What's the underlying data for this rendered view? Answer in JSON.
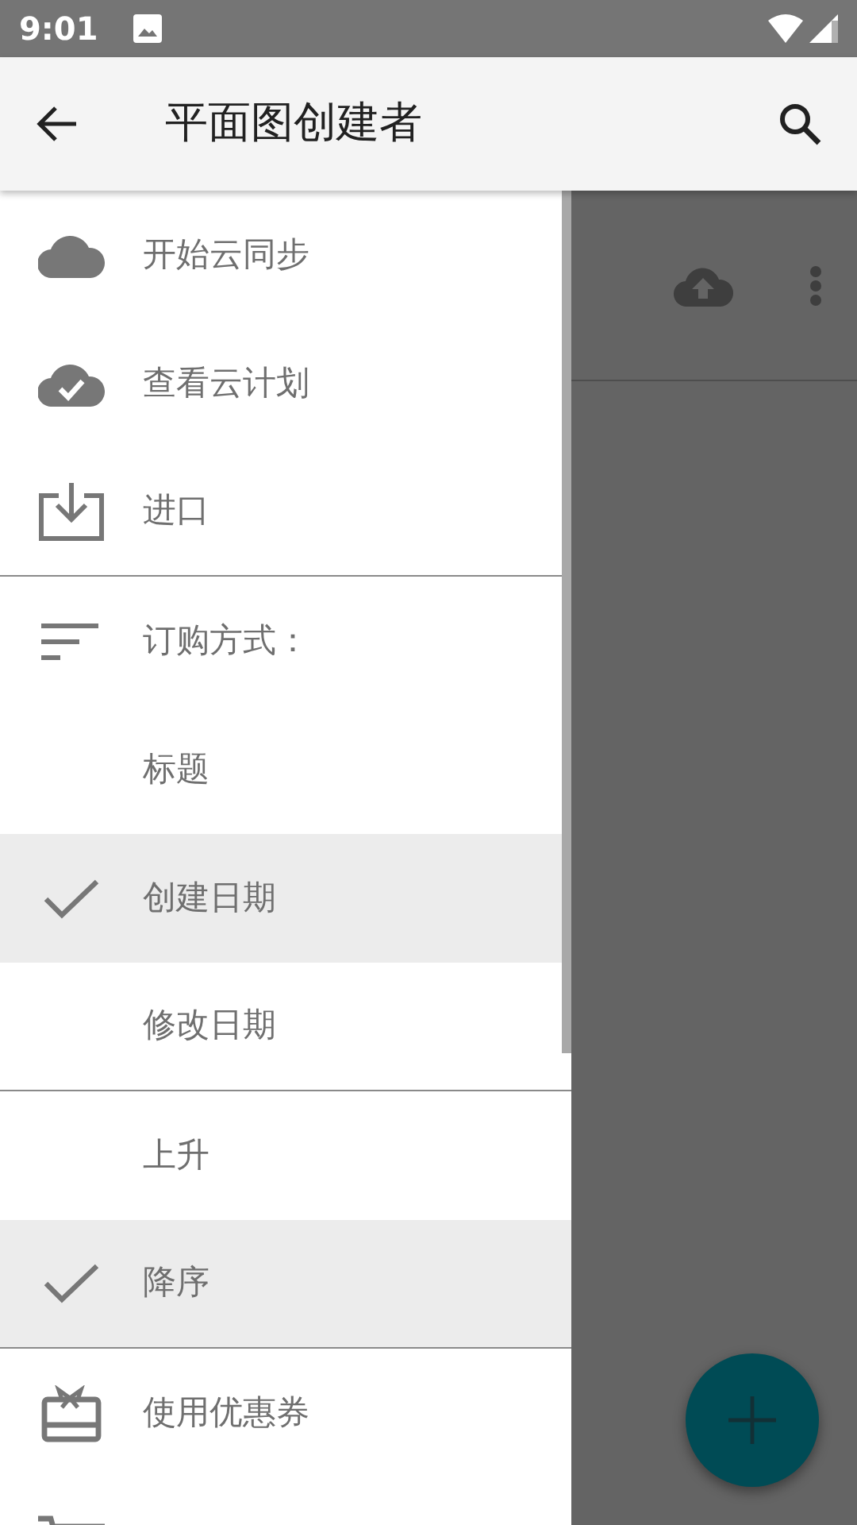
{
  "status_bar": {
    "time": "9:01"
  },
  "app_bar": {
    "title": "平面图创建者"
  },
  "menu": [
    {
      "kind": "action",
      "label": "开始云同步"
    },
    {
      "kind": "action",
      "label": "查看云计划"
    },
    {
      "kind": "action",
      "label": "进口",
      "divider_after": true
    },
    {
      "kind": "heading",
      "label": "订购方式："
    },
    {
      "kind": "option",
      "label": "标题",
      "selected": false
    },
    {
      "kind": "option",
      "label": "创建日期",
      "selected": true
    },
    {
      "kind": "option",
      "label": "修改日期",
      "selected": false,
      "divider_after": true
    },
    {
      "kind": "option",
      "label": "上升",
      "selected": false
    },
    {
      "kind": "option",
      "label": "降序",
      "selected": true,
      "divider_after": true
    },
    {
      "kind": "action",
      "label": "使用优惠券"
    },
    {
      "kind": "action"
    }
  ]
}
